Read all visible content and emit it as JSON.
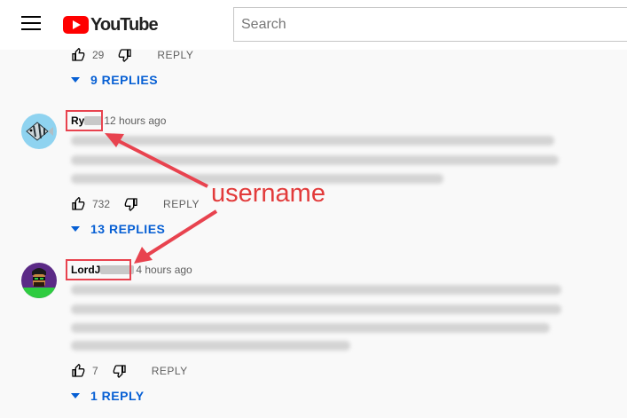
{
  "header": {
    "logo_text": "YouTube",
    "search_placeholder": "Search"
  },
  "comments": [
    {
      "likes": "29",
      "reply_label": "REPLY",
      "replies_label": "9 REPLIES"
    },
    {
      "author": "Ry",
      "timestamp": "12 hours ago",
      "likes": "732",
      "reply_label": "REPLY",
      "replies_label": "13 REPLIES",
      "avatar": "angelfish-avatar"
    },
    {
      "author": "LordJ",
      "timestamp": "4 hours ago",
      "likes": "7",
      "reply_label": "REPLY",
      "replies_label": "1 REPLY",
      "avatar": "cartoon-person-avatar"
    }
  ],
  "annotation": {
    "label": "username",
    "color": "#e23b3b"
  },
  "colors": {
    "brand_red": "#ff0000",
    "link_blue": "#065fd4"
  }
}
